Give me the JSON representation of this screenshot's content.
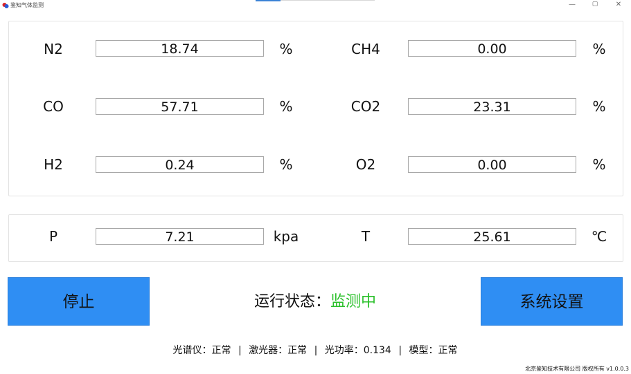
{
  "window": {
    "title": "鉴知气体监测",
    "minimize": "—",
    "maximize": "▢",
    "close": "✕"
  },
  "gases": [
    {
      "label": "N2",
      "value": "18.74",
      "unit": "%"
    },
    {
      "label": "CH4",
      "value": "0.00",
      "unit": "%"
    },
    {
      "label": "CO",
      "value": "57.71",
      "unit": "%"
    },
    {
      "label": "CO2",
      "value": "23.31",
      "unit": "%"
    },
    {
      "label": "H2",
      "value": "0.24",
      "unit": "%"
    },
    {
      "label": "O2",
      "value": "0.00",
      "unit": "%"
    }
  ],
  "environment": [
    {
      "label": "P",
      "value": "7.21",
      "unit": "kpa"
    },
    {
      "label": "T",
      "value": "25.61",
      "unit": "℃"
    }
  ],
  "controls": {
    "stop_label": "停止",
    "settings_label": "系统设置"
  },
  "status": {
    "label": "运行状态：",
    "value": "监测中",
    "value_color": "#2bc02b"
  },
  "footer": {
    "spectrometer": "光谱仪：正常",
    "laser": "激光器：正常",
    "optical_power": "光功率：0.134",
    "model": "模型：正常",
    "separator": "|",
    "copyright": "北京鉴知技术有限公司 版权所有 v1.0.0.3"
  },
  "colors": {
    "button_blue": "#2f8ef3",
    "status_green": "#2bc02b",
    "logo_red": "#d9252b",
    "logo_blue": "#2a5bd7"
  },
  "icons": {
    "app": "app-logo-icon"
  }
}
